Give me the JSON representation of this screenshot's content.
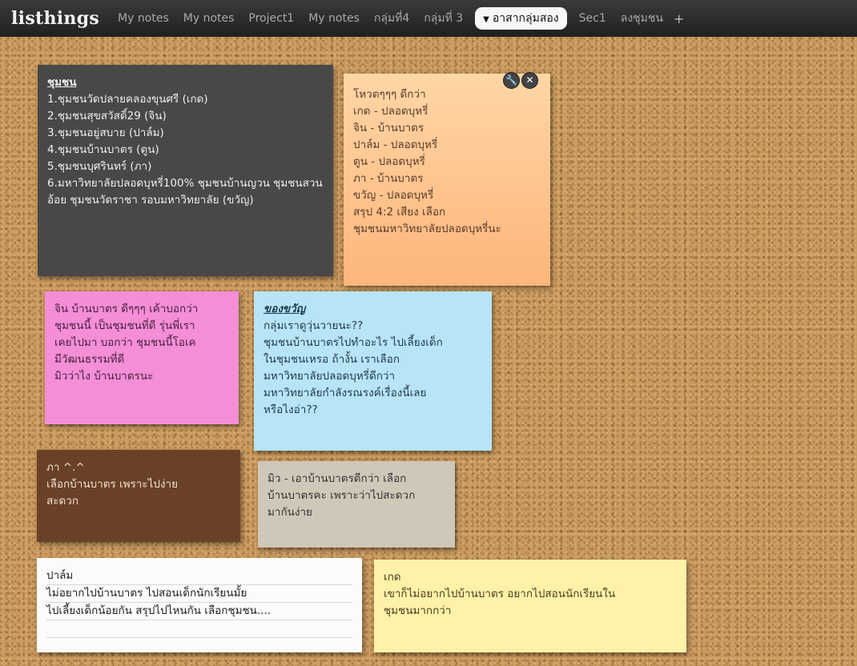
{
  "app": {
    "brand": "listhings"
  },
  "tabs": [
    {
      "label": "My notes",
      "active": false
    },
    {
      "label": "My notes",
      "active": false
    },
    {
      "label": "Project1",
      "active": false
    },
    {
      "label": "My notes",
      "active": false
    },
    {
      "label": "กลุ่มที่4",
      "active": false
    },
    {
      "label": "กลุ่มที่ 3",
      "active": false
    },
    {
      "label": "อาสากลุ่มสอง",
      "active": true
    },
    {
      "label": "Sec1",
      "active": false
    },
    {
      "label": "ลงชุมชน",
      "active": false
    }
  ],
  "add_tab": "+",
  "icons": {
    "edit": "wrench-icon",
    "close": "close-icon",
    "caret": "caret-down-icon"
  },
  "notes": {
    "dark": {
      "title": "ชุมชน",
      "body": "1.ชุมชนวัดปลายคลองขุนศรี (เกด)\n2.ชุมชนสุขสวัสดิ์29 (จิน)\n3.ชุมชนอยู่สบาย (ปาล์ม)\n4.ชุมชนบ้านบาตร (ตูน)\n5.ชุมชนบุศรินทร์ (ภา)\n6.มหาวิทยาลัยปลอดบุหรี่100% ชุมชนบ้านญวน ชุมชนสวนอ้อย ชุมชนวัดราชา รอบมหาวิทยาลัย (ขวัญ)"
    },
    "orange": {
      "body": "โหวตๆๆๆ ดีกว่า\nเกด - ปลอดบุหรี่\nจิน - บ้านบาตร\nปาล์ม - ปลอดบุหรี่\nตูน - ปลอดบุหรี่\nภา - บ้านบาตร\nขวัญ - ปลอดบุหรี่\nสรุป 4:2 เสียง เลือก\nชุมชนมหาวิทยาลัยปลอดบุหรี่นะ"
    },
    "pink": {
      "body": "จิน บ้านบาตร ดีๆๆๆ  เค้าบอกว่า\nชุมชนนี้ เป็นชุมชนที่ดี  รุ่นพี่เรา\nเคยไปมา บอกว่า ชุมชนนี้โอเค\n มีวัฒนธรรมที่ดี\nมิวว่าไง  บ้านบาตรนะ"
    },
    "blue": {
      "title": "ของขวัญ",
      "body": "กลุ่มเราดูวุ่นวายนะ??\nชุมชนบ้านบาตรไปทำอะไร ไปเลี้ยงเด็ก\nในชุมชนเหรอ ถ้างั้น เราเลือก\nมหาวิทยาลัยปลอดบุหรี่ดีกว่า\nมหาวิทยาลัยกำลังรณรงค์เรื่องนี้เลย\nหรือไงอ่า??"
    },
    "brown": {
      "body": "ภา ^.^\nเลือกบ้านบาตร เพราะไปง่าย\nสะดวก"
    },
    "grey": {
      "body": "มิว - เอาบ้านบาตรดีกว่า เลือก\nบ้านบาตรคะ เพราะว่าไปสะดวก\nมากันง่าย"
    },
    "white": {
      "lines": [
        "ปาล์ม",
        "ไม่อยากไปบ้านบาตร ไปสอนเด็กนักเรียนมั้ย",
        "ไปเลี้ยงเด็กน้อยกัน สรุปไปไหนกัน เลือกชุมชน....",
        ""
      ]
    },
    "yellow": {
      "body": "เกด\nเขาก็ไม่อยากไปบ้านบาตร อยากไปสอนนักเรียนใน\nชุมชนมากกว่า"
    }
  }
}
